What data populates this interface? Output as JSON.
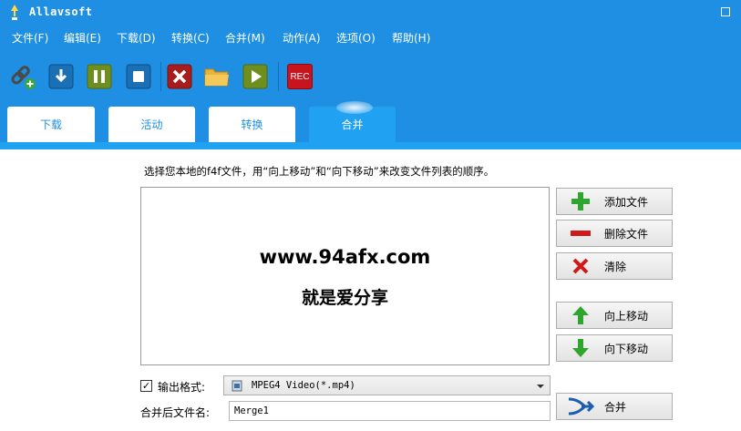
{
  "window": {
    "title": "Allavsoft"
  },
  "menu": [
    {
      "label": "文件(F)"
    },
    {
      "label": "编辑(E)"
    },
    {
      "label": "下载(D)"
    },
    {
      "label": "转换(C)"
    },
    {
      "label": "合并(M)"
    },
    {
      "label": "动作(A)"
    },
    {
      "label": "选项(O)"
    },
    {
      "label": "帮助(H)"
    }
  ],
  "toolbar": {
    "rec_label": "REC",
    "icons": [
      "link-add-icon",
      "download-icon",
      "pause-icon",
      "stop-icon",
      "delete-icon",
      "folder-icon",
      "play-icon",
      "rec-icon"
    ]
  },
  "tabs": [
    {
      "label": "下载"
    },
    {
      "label": "活动"
    },
    {
      "label": "转换"
    },
    {
      "label": "合并",
      "active": true
    }
  ],
  "merge": {
    "instruction": "选择您本地的f4f文件，用“向上移动”和“向下移动”来改变文件列表的顺序。",
    "watermark_url": "www.94afx.com",
    "watermark_text": "就是爱分享",
    "buttons": {
      "add_file": "添加文件",
      "delete_file": "删除文件",
      "clear": "清除",
      "move_up": "向上移动",
      "move_down": "向下移动",
      "merge": "合并"
    },
    "output_format_checked": true,
    "output_format_label": "输出格式:",
    "output_format_value": "MPEG4 Video(*.mp4)",
    "merged_name_label": "合并后文件名:",
    "merged_name_value": "Merge1"
  },
  "colors": {
    "accent": "#1e8fe2",
    "tab_active": "#21a1f1"
  }
}
